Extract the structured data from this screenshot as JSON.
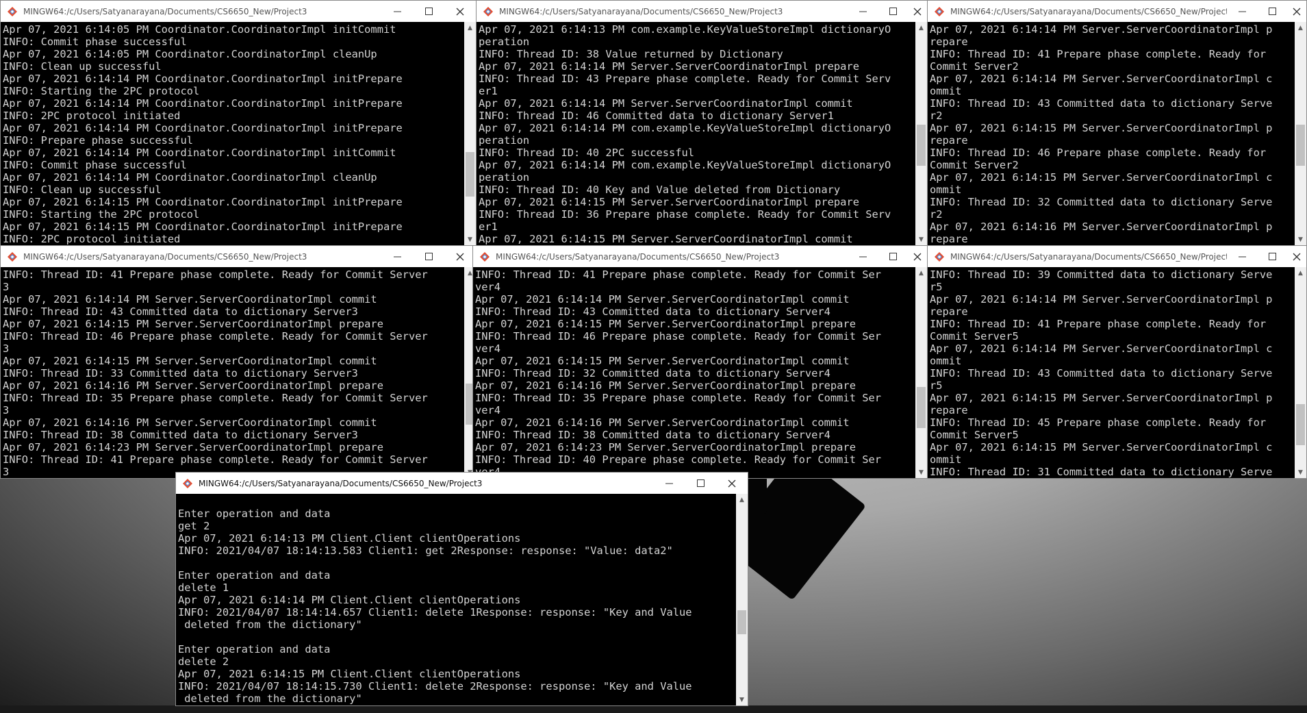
{
  "window_title": "MINGW64:/c/Users/Satyanarayana/Documents/CS6650_New/Project3",
  "icons": {
    "app": "git-bash-icon",
    "minimize": "minimize-icon",
    "maximize": "maximize-icon",
    "close": "close-icon"
  },
  "windows": [
    {
      "id": "coordinator",
      "lines": [
        "Apr 07, 2021 6:14:05 PM Coordinator.CoordinatorImpl initCommit",
        "INFO: Commit phase successful",
        "Apr 07, 2021 6:14:05 PM Coordinator.CoordinatorImpl cleanUp",
        "INFO: Clean up successful",
        "Apr 07, 2021 6:14:14 PM Coordinator.CoordinatorImpl initPrepare",
        "INFO: Starting the 2PC protocol",
        "Apr 07, 2021 6:14:14 PM Coordinator.CoordinatorImpl initPrepare",
        "INFO: 2PC protocol initiated",
        "Apr 07, 2021 6:14:14 PM Coordinator.CoordinatorImpl initPrepare",
        "INFO: Prepare phase successful",
        "Apr 07, 2021 6:14:14 PM Coordinator.CoordinatorImpl initCommit",
        "INFO: Commit phase successful",
        "Apr 07, 2021 6:14:14 PM Coordinator.CoordinatorImpl cleanUp",
        "INFO: Clean up successful",
        "Apr 07, 2021 6:14:15 PM Coordinator.CoordinatorImpl initPrepare",
        "INFO: Starting the 2PC protocol",
        "Apr 07, 2021 6:14:15 PM Coordinator.CoordinatorImpl initPrepare",
        "INFO: 2PC protocol initiated"
      ]
    },
    {
      "id": "server1",
      "lines": [
        "Apr 07, 2021 6:14:13 PM com.example.KeyValueStoreImpl dictionaryO",
        "peration",
        "INFO: Thread ID: 38 Value returned by Dictionary",
        "Apr 07, 2021 6:14:14 PM Server.ServerCoordinatorImpl prepare",
        "INFO: Thread ID: 43 Prepare phase complete. Ready for Commit Serv",
        "er1",
        "Apr 07, 2021 6:14:14 PM Server.ServerCoordinatorImpl commit",
        "INFO: Thread ID: 46 Committed data to dictionary Server1",
        "Apr 07, 2021 6:14:14 PM com.example.KeyValueStoreImpl dictionaryO",
        "peration",
        "INFO: Thread ID: 40 2PC successful",
        "Apr 07, 2021 6:14:14 PM com.example.KeyValueStoreImpl dictionaryO",
        "peration",
        "INFO: Thread ID: 40 Key and Value deleted from Dictionary",
        "Apr 07, 2021 6:14:15 PM Server.ServerCoordinatorImpl prepare",
        "INFO: Thread ID: 36 Prepare phase complete. Ready for Commit Serv",
        "er1",
        "Apr 07, 2021 6:14:15 PM Server.ServerCoordinatorImpl commit"
      ]
    },
    {
      "id": "server2",
      "lines": [
        "Apr 07, 2021 6:14:14 PM Server.ServerCoordinatorImpl p",
        "repare",
        "INFO: Thread ID: 41 Prepare phase complete. Ready for",
        "Commit Server2",
        "Apr 07, 2021 6:14:14 PM Server.ServerCoordinatorImpl c",
        "ommit",
        "INFO: Thread ID: 43 Committed data to dictionary Serve",
        "r2",
        "Apr 07, 2021 6:14:15 PM Server.ServerCoordinatorImpl p",
        "repare",
        "INFO: Thread ID: 46 Prepare phase complete. Ready for",
        "Commit Server2",
        "Apr 07, 2021 6:14:15 PM Server.ServerCoordinatorImpl c",
        "ommit",
        "INFO: Thread ID: 32 Committed data to dictionary Serve",
        "r2",
        "Apr 07, 2021 6:14:16 PM Server.ServerCoordinatorImpl p",
        "repare"
      ]
    },
    {
      "id": "server3",
      "lines": [
        "INFO: Thread ID: 41 Prepare phase complete. Ready for Commit Server",
        "3",
        "Apr 07, 2021 6:14:14 PM Server.ServerCoordinatorImpl commit",
        "INFO: Thread ID: 43 Committed data to dictionary Server3",
        "Apr 07, 2021 6:14:15 PM Server.ServerCoordinatorImpl prepare",
        "INFO: Thread ID: 46 Prepare phase complete. Ready for Commit Server",
        "3",
        "Apr 07, 2021 6:14:15 PM Server.ServerCoordinatorImpl commit",
        "INFO: Thread ID: 33 Committed data to dictionary Server3",
        "Apr 07, 2021 6:14:16 PM Server.ServerCoordinatorImpl prepare",
        "INFO: Thread ID: 35 Prepare phase complete. Ready for Commit Server",
        "3",
        "Apr 07, 2021 6:14:16 PM Server.ServerCoordinatorImpl commit",
        "INFO: Thread ID: 38 Committed data to dictionary Server3",
        "Apr 07, 2021 6:14:23 PM Server.ServerCoordinatorImpl prepare",
        "INFO: Thread ID: 41 Prepare phase complete. Ready for Commit Server",
        "3"
      ]
    },
    {
      "id": "server4",
      "lines": [
        "INFO: Thread ID: 41 Prepare phase complete. Ready for Commit Ser",
        "ver4",
        "Apr 07, 2021 6:14:14 PM Server.ServerCoordinatorImpl commit",
        "INFO: Thread ID: 43 Committed data to dictionary Server4",
        "Apr 07, 2021 6:14:15 PM Server.ServerCoordinatorImpl prepare",
        "INFO: Thread ID: 46 Prepare phase complete. Ready for Commit Ser",
        "ver4",
        "Apr 07, 2021 6:14:15 PM Server.ServerCoordinatorImpl commit",
        "INFO: Thread ID: 32 Committed data to dictionary Server4",
        "Apr 07, 2021 6:14:16 PM Server.ServerCoordinatorImpl prepare",
        "INFO: Thread ID: 35 Prepare phase complete. Ready for Commit Ser",
        "ver4",
        "Apr 07, 2021 6:14:16 PM Server.ServerCoordinatorImpl commit",
        "INFO: Thread ID: 38 Committed data to dictionary Server4",
        "Apr 07, 2021 6:14:23 PM Server.ServerCoordinatorImpl prepare",
        "INFO: Thread ID: 40 Prepare phase complete. Ready for Commit Ser",
        "ver4"
      ]
    },
    {
      "id": "server5",
      "lines": [
        "INFO: Thread ID: 39 Committed data to dictionary Serve",
        "r5",
        "Apr 07, 2021 6:14:14 PM Server.ServerCoordinatorImpl p",
        "repare",
        "INFO: Thread ID: 41 Prepare phase complete. Ready for",
        "Commit Server5",
        "Apr 07, 2021 6:14:14 PM Server.ServerCoordinatorImpl c",
        "ommit",
        "INFO: Thread ID: 43 Committed data to dictionary Serve",
        "r5",
        "Apr 07, 2021 6:14:15 PM Server.ServerCoordinatorImpl p",
        "repare",
        "INFO: Thread ID: 45 Prepare phase complete. Ready for",
        "Commit Server5",
        "Apr 07, 2021 6:14:15 PM Server.ServerCoordinatorImpl c",
        "ommit",
        "INFO: Thread ID: 31 Committed data to dictionary Serve"
      ]
    },
    {
      "id": "client",
      "lines": [
        "",
        "Enter operation and data",
        "get 2",
        "Apr 07, 2021 6:14:13 PM Client.Client clientOperations",
        "INFO: 2021/04/07 18:14:13.583 Client1: get 2Response: response: \"Value: data2\"",
        "",
        "Enter operation and data",
        "delete 1",
        "Apr 07, 2021 6:14:14 PM Client.Client clientOperations",
        "INFO: 2021/04/07 18:14:14.657 Client1: delete 1Response: response: \"Key and Value",
        " deleted from the dictionary\"",
        "",
        "Enter operation and data",
        "delete 2",
        "Apr 07, 2021 6:14:15 PM Client.Client clientOperations",
        "INFO: 2021/04/07 18:14:15.730 Client1: delete 2Response: response: \"Key and Value",
        " deleted from the dictionary\""
      ]
    }
  ]
}
